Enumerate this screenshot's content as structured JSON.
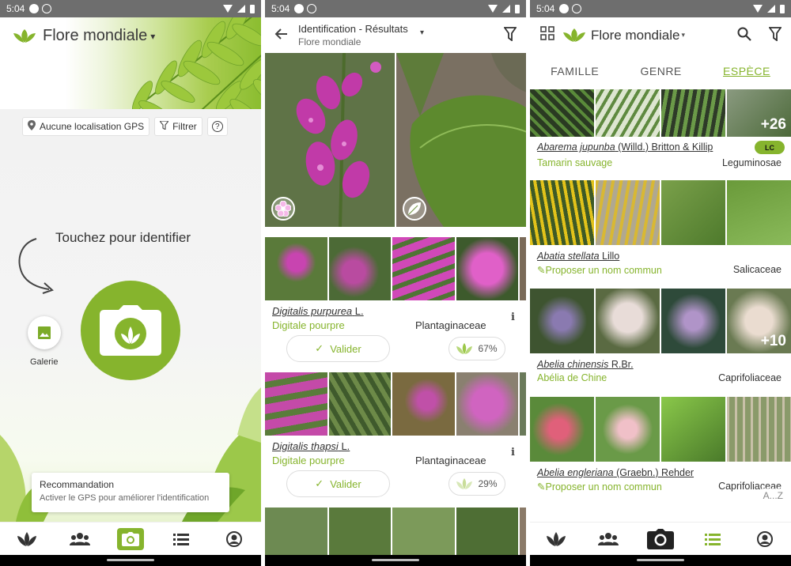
{
  "status": {
    "time": "5:04"
  },
  "screen1": {
    "app_title": "Flore mondiale",
    "gps_chip": "Aucune localisation GPS",
    "filter_chip": "Filtrer",
    "help_chip": "?",
    "touch_text": "Touchez pour identifier",
    "gallery_label": "Galerie",
    "recommendation_title": "Recommandation",
    "recommendation_text": "Activer le GPS pour améliorer l'identification"
  },
  "screen2": {
    "title": "Identification - Résultats",
    "subtitle": "Flore mondiale",
    "results": [
      {
        "sci_name": "Digitalis purpurea",
        "author": "L.",
        "common": "Digitale pourpre",
        "family": "Plantaginaceae",
        "validate_label": "Valider",
        "score": "67%"
      },
      {
        "sci_name": "Digitalis thapsi",
        "author": "L.",
        "common": "Digitale pourpre",
        "family": "Plantaginaceae",
        "validate_label": "Valider",
        "score": "29%"
      }
    ]
  },
  "screen3": {
    "app_title": "Flore mondiale",
    "tabs": [
      "FAMILLE",
      "GENRE",
      "ESPÈCE"
    ],
    "species": [
      {
        "sci_name": "Abarema jupunba",
        "author": "(Willd.) Britton & Killip",
        "common": "Tamarin sauvage",
        "family": "Leguminosae",
        "more": "+26",
        "badge": "LC"
      },
      {
        "sci_name": "Abatia stellata",
        "author": "Lillo",
        "common": "Proposer un nom commun",
        "family": "Salicaceae",
        "more": ""
      },
      {
        "sci_name": "Abelia chinensis",
        "author": "R.Br.",
        "common": "Abélia de Chine",
        "family": "Caprifoliaceae",
        "more": "+10"
      },
      {
        "sci_name": "Abelia engleriana",
        "author": "(Graebn.) Rehder",
        "common": "Proposer un nom commun",
        "family": "Caprifoliaceae",
        "more": ""
      }
    ],
    "az_label": "A...Z"
  },
  "colors": {
    "accent": "#86b42d",
    "status_bar": "#6e6e6e"
  }
}
